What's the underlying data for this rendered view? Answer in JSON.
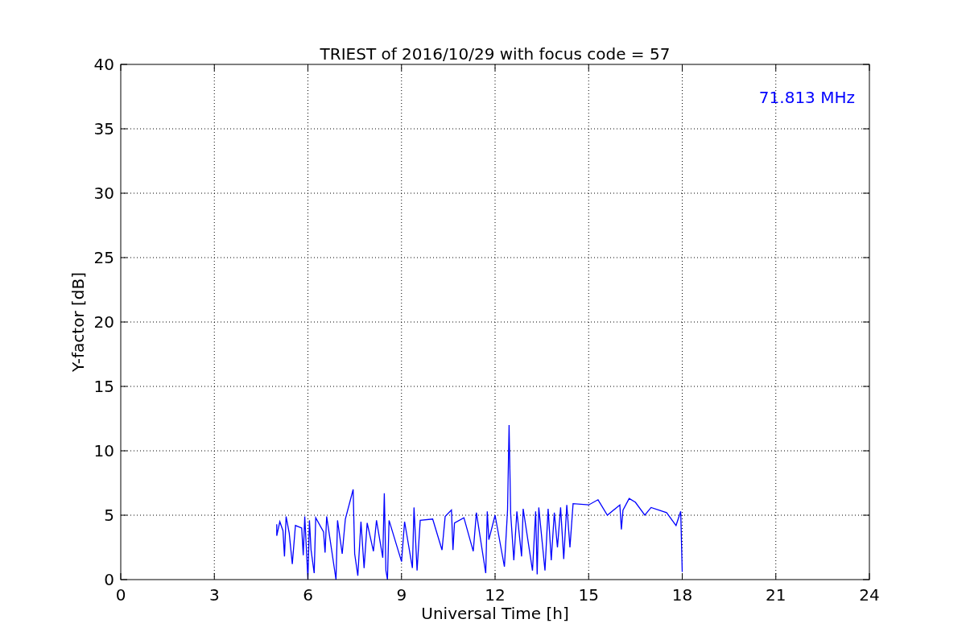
{
  "figure": {
    "chart_data": {
      "type": "line",
      "title": "TRIEST of 2016/10/29 with focus code = 57",
      "xlabel": "Universal Time [h]",
      "ylabel": "Y-factor [dB]",
      "xlim": [
        0,
        24
      ],
      "ylim": [
        0,
        40
      ],
      "xticks": [
        0,
        3,
        6,
        9,
        12,
        15,
        18,
        21,
        24
      ],
      "yticks": [
        0,
        5,
        10,
        15,
        20,
        25,
        30,
        35,
        40
      ],
      "x": [
        5.0,
        5.0,
        5.1,
        5.2,
        5.25,
        5.3,
        5.4,
        5.5,
        5.6,
        5.8,
        5.85,
        5.9,
        6.0,
        6.05,
        6.1,
        6.2,
        6.25,
        6.5,
        6.55,
        6.6,
        6.9,
        6.95,
        7.1,
        7.2,
        7.45,
        7.5,
        7.6,
        7.7,
        7.8,
        7.9,
        8.1,
        8.2,
        8.4,
        8.45,
        8.5,
        8.55,
        8.6,
        9.0,
        9.1,
        9.35,
        9.4,
        9.5,
        9.6,
        10.0,
        10.3,
        10.4,
        10.6,
        10.65,
        10.7,
        11.0,
        11.3,
        11.4,
        11.7,
        11.75,
        11.8,
        12.0,
        12.3,
        12.4,
        12.45,
        12.5,
        12.6,
        12.7,
        12.85,
        12.9,
        13.2,
        13.3,
        13.35,
        13.4,
        13.6,
        13.7,
        13.8,
        13.9,
        14.0,
        14.1,
        14.2,
        14.3,
        14.4,
        14.5,
        15.0,
        15.3,
        15.6,
        16.0,
        16.05,
        16.1,
        16.3,
        16.5,
        16.8,
        17.0,
        17.5,
        17.8,
        17.95,
        18.0
      ],
      "series": [
        {
          "color": "#0000ff",
          "values": [
            4.3,
            3.4,
            4.5,
            3.8,
            1.8,
            4.9,
            3.6,
            1.2,
            4.2,
            4.0,
            1.9,
            4.9,
            0,
            4.6,
            2.3,
            0.5,
            4.8,
            3.7,
            2.1,
            4.9,
            0,
            4.6,
            2.0,
            4.7,
            7.0,
            2.0,
            0.3,
            4.5,
            0.9,
            4.4,
            2.2,
            4.6,
            1.7,
            6.7,
            0.7,
            0,
            4.6,
            1.4,
            4.5,
            0.9,
            5.6,
            0.7,
            4.6,
            4.7,
            2.3,
            4.9,
            5.4,
            2.3,
            4.4,
            4.8,
            2.2,
            5.2,
            0.5,
            5.3,
            3.1,
            5.0,
            1.0,
            5.4,
            12.0,
            5.1,
            1.5,
            5.3,
            1.8,
            5.5,
            0.7,
            5.3,
            0.4,
            5.6,
            0.7,
            5.5,
            1.5,
            5.2,
            2.5,
            5.6,
            1.6,
            5.8,
            2.5,
            5.9,
            5.8,
            6.2,
            5.0,
            5.8,
            3.9,
            5.4,
            6.3,
            6.0,
            5.0,
            5.6,
            5.2,
            4.2,
            5.3,
            0.6
          ]
        }
      ],
      "grid": true,
      "annotations": [
        "71.813 MHz"
      ]
    }
  }
}
